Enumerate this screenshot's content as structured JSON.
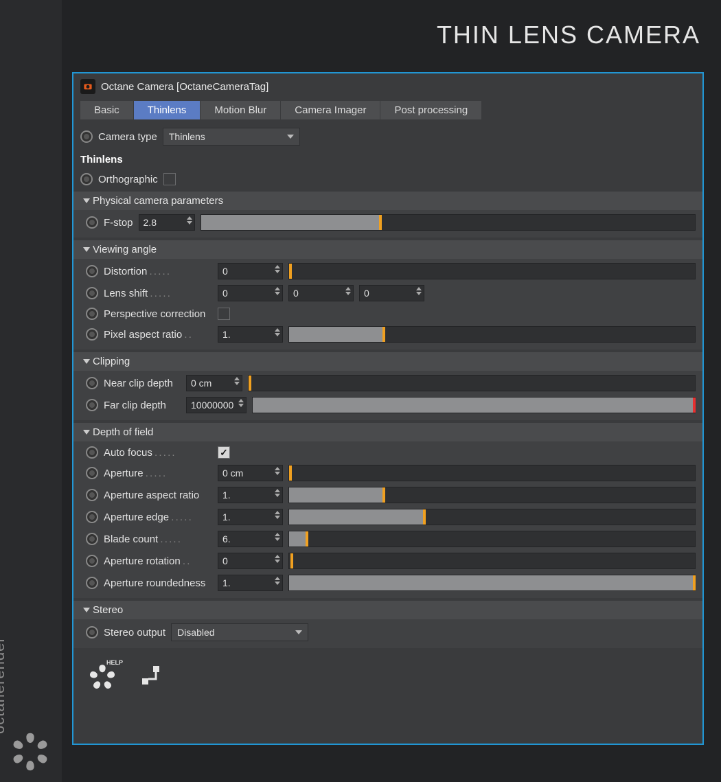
{
  "brand": {
    "name": "octanerender",
    "tm": "™"
  },
  "page_title": "THIN LENS CAMERA",
  "panel_title": "Octane Camera [OctaneCameraTag]",
  "tabs": {
    "basic": "Basic",
    "thinlens": "Thinlens",
    "motion_blur": "Motion Blur",
    "camera_imager": "Camera Imager",
    "post": "Post processing"
  },
  "camera_type": {
    "label": "Camera type",
    "value": "Thinlens"
  },
  "section": "Thinlens",
  "orthographic": {
    "label": "Orthographic",
    "checked": false
  },
  "groups": {
    "physical": {
      "title": "Physical camera parameters",
      "fstop": {
        "label": "F-stop",
        "value": "2.8",
        "fill": 36
      }
    },
    "viewing": {
      "title": "Viewing angle",
      "distortion": {
        "label": "Distortion",
        "value": "0",
        "fill": 0
      },
      "lens_shift": {
        "label": "Lens shift",
        "x": "0",
        "y": "0",
        "z": "0"
      },
      "perspective_corr": {
        "label": "Perspective correction",
        "checked": false
      },
      "pixel_aspect": {
        "label": "Pixel aspect ratio",
        "value": "1.",
        "fill": 23
      }
    },
    "clipping": {
      "title": "Clipping",
      "near": {
        "label": "Near clip depth",
        "value": "0 cm",
        "fill": 0
      },
      "far": {
        "label": "Far clip depth",
        "value": "10000000",
        "fill": 99.5,
        "handle_color": "red"
      }
    },
    "dof": {
      "title": "Depth of field",
      "auto_focus": {
        "label": "Auto focus",
        "checked": true
      },
      "aperture": {
        "label": "Aperture",
        "value": "0 cm",
        "fill": 0
      },
      "aperture_aspect": {
        "label": "Aperture aspect ratio",
        "value": "1.",
        "fill": 23
      },
      "aperture_edge": {
        "label": "Aperture edge",
        "value": "1.",
        "fill": 33
      },
      "blade_count": {
        "label": "Blade count",
        "value": "6.",
        "fill": 4
      },
      "aperture_rotation": {
        "label": "Aperture rotation",
        "value": "0",
        "fill": 0.3
      },
      "aperture_roundedness": {
        "label": "Aperture roundedness",
        "value": "1.",
        "fill": 99.5
      }
    },
    "stereo": {
      "title": "Stereo",
      "output": {
        "label": "Stereo output",
        "value": "Disabled"
      }
    }
  },
  "footer": {
    "help": "HELP"
  }
}
